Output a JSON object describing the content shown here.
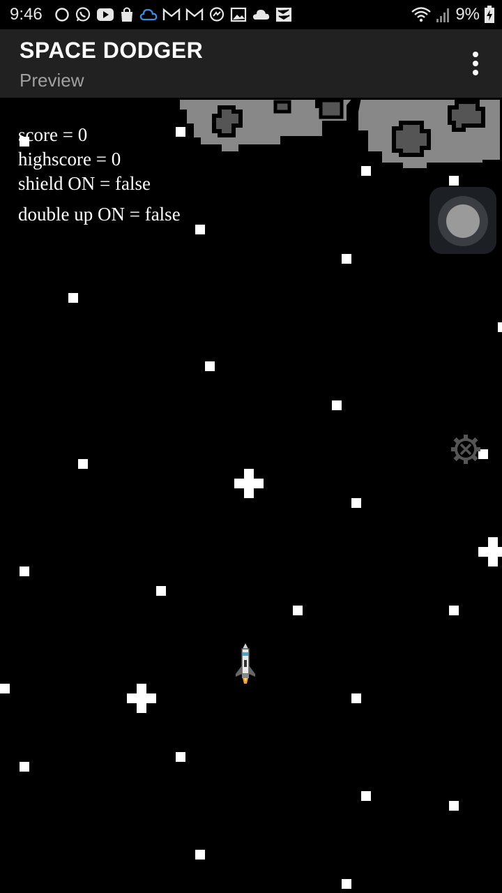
{
  "status_bar": {
    "time": "9:46",
    "battery_percent": "9%",
    "icons": [
      "circle-icon",
      "whatsapp-icon",
      "youtube-icon",
      "shopping-bag-icon",
      "cloud-outline-icon",
      "gmail-icon",
      "gmail-icon",
      "messenger-icon",
      "gallery-icon",
      "cloud-icon",
      "map-icon",
      "wifi-icon",
      "signal-icon",
      "battery-charging-icon"
    ]
  },
  "app_bar": {
    "title": "SPACE DODGER",
    "subtitle": "Preview",
    "menu_icon": "more-vert-icon"
  },
  "hud": {
    "score": "score = 0",
    "highscore": "highscore = 0",
    "shield": "shield ON = false",
    "double_up": "double up ON = false"
  },
  "game_objects": {
    "player": "rocket-icon",
    "obstacles": "asteroid-icon",
    "controls": [
      "joystick",
      "settings-gear-icon"
    ]
  },
  "colors": {
    "background": "#000000",
    "app_bar": "#212121",
    "asteroid": "#888888",
    "star": "#ffffff"
  }
}
